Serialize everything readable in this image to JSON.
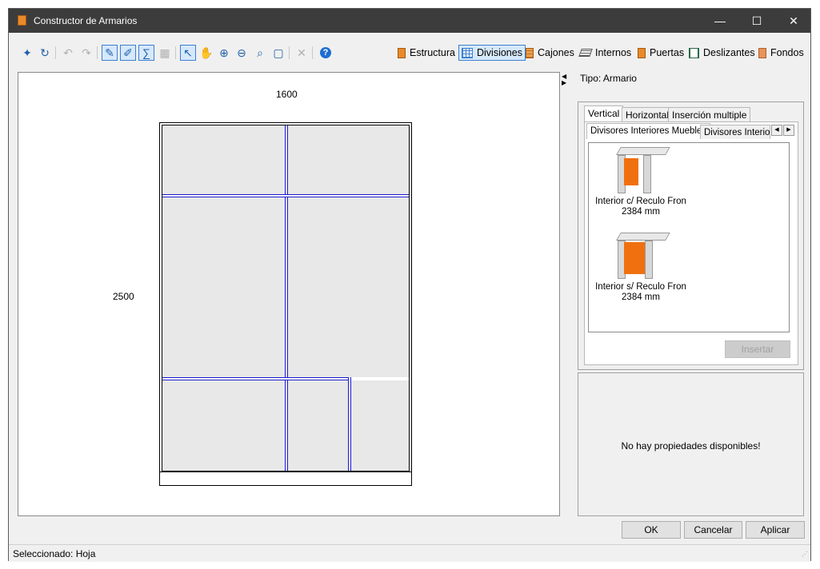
{
  "window": {
    "title": "Constructor de Armarios",
    "controls": [
      "—",
      "☐",
      "✕"
    ]
  },
  "toolbar": {
    "tools": [
      {
        "name": "new-icon",
        "glyph": "✦"
      },
      {
        "name": "refresh-icon",
        "glyph": "↻"
      },
      {
        "name": "undo-icon",
        "glyph": "↶"
      },
      {
        "name": "redo-icon",
        "glyph": "↷"
      },
      {
        "name": "draw-tool-icon",
        "glyph": "✎"
      },
      {
        "name": "draw-alt-tool-icon",
        "glyph": "✐"
      },
      {
        "name": "sum-tool-icon",
        "glyph": "∑"
      },
      {
        "name": "grid-tool-icon",
        "glyph": "▦"
      },
      {
        "name": "select-arrow-icon",
        "glyph": "↖"
      },
      {
        "name": "pan-hand-icon",
        "glyph": "✋"
      },
      {
        "name": "zoom-in-icon",
        "glyph": "⊕"
      },
      {
        "name": "zoom-out-icon",
        "glyph": "⊖"
      },
      {
        "name": "zoom-fit-icon",
        "glyph": "⌕"
      },
      {
        "name": "window-icon",
        "glyph": "▢"
      },
      {
        "name": "delete-icon",
        "glyph": "✕"
      },
      {
        "name": "help-icon",
        "glyph": "?"
      }
    ],
    "ribbon": [
      {
        "label": "Estructura",
        "icon": "structure-icon"
      },
      {
        "label": "Divisiones",
        "icon": "divisions-icon"
      },
      {
        "label": "Cajones",
        "icon": "drawers-icon"
      },
      {
        "label": "Internos",
        "icon": "internals-icon"
      },
      {
        "label": "Puertas",
        "icon": "doors-icon"
      },
      {
        "label": "Deslizantes",
        "icon": "sliding-icon"
      },
      {
        "label": "Fondos",
        "icon": "backs-icon"
      }
    ],
    "ribbon_active": "Divisiones"
  },
  "canvas": {
    "width_label": "1600",
    "height_label": "2500"
  },
  "side": {
    "tipo": "Tipo: Armario",
    "tabs": [
      "Vertical",
      "Horizontal",
      "Inserción multiple"
    ],
    "subtabs": [
      "Divisores Interiores Muebles",
      "Divisores Interiores"
    ],
    "items": [
      {
        "name": "Interior c/ Reculo Fron",
        "size": "2384 mm"
      },
      {
        "name": "Interior s/ Reculo Fron",
        "size": "2384 mm"
      }
    ],
    "insert_label": "Insertar",
    "no_props": "No hay propiedades disponibles!"
  },
  "buttons": {
    "ok": "OK",
    "cancel": "Cancelar",
    "apply": "Aplicar"
  },
  "status": {
    "selected": "Seleccionado: Hoja"
  },
  "colors": {
    "divider": "#1a1ad0",
    "cell": "#e8e8e8",
    "accent_orange": "#f07010",
    "titlebar": "#3c3c3c"
  }
}
